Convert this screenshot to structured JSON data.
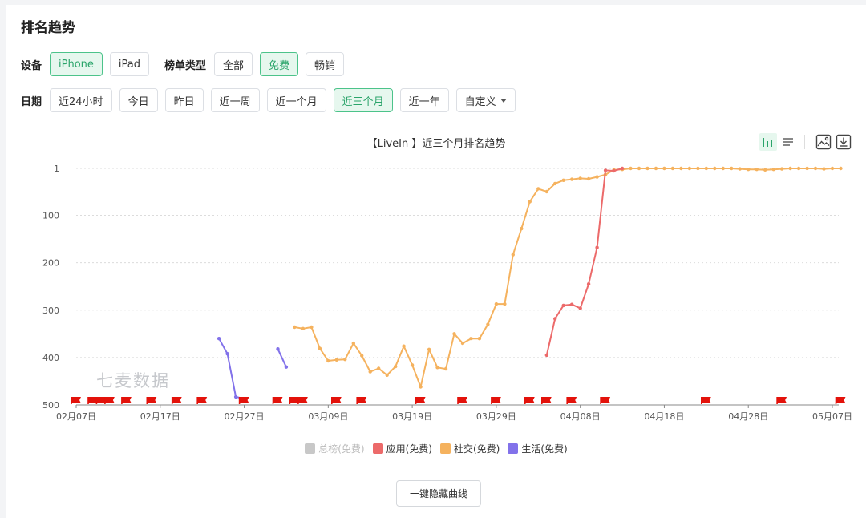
{
  "page": {
    "title": "排名趋势"
  },
  "filters": {
    "device_label": "设备",
    "devices": [
      {
        "label": "iPhone",
        "active": true
      },
      {
        "label": "iPad",
        "active": false
      }
    ],
    "list_type_label": "榜单类型",
    "list_types": [
      {
        "label": "全部",
        "active": false
      },
      {
        "label": "免费",
        "active": true
      },
      {
        "label": "畅销",
        "active": false
      }
    ],
    "date_label": "日期",
    "dates": [
      {
        "label": "近24小时",
        "active": false
      },
      {
        "label": "今日",
        "active": false
      },
      {
        "label": "昨日",
        "active": false
      },
      {
        "label": "近一周",
        "active": false
      },
      {
        "label": "近一个月",
        "active": false
      },
      {
        "label": "近三个月",
        "active": true
      },
      {
        "label": "近一年",
        "active": false
      }
    ],
    "custom_label": "自定义"
  },
  "watermark": "七麦数据",
  "hide_button": "一键隐藏曲线",
  "colors": {
    "accent": "#2aa46a",
    "social": "#f5b25e",
    "app": "#ec6a6a",
    "life": "#8272ea",
    "total": "#c8c8c8",
    "flag": "#e3120b"
  },
  "chart_data": {
    "type": "line",
    "title": "【LiveIn 】近三个月排名趋势",
    "y_reversed": true,
    "ylim": [
      1,
      500
    ],
    "yticks": [
      1,
      100,
      200,
      300,
      400,
      500
    ],
    "x_start": "2024-02-07",
    "x_end": "2024-05-07",
    "xticks": [
      "02月07日",
      "02月17日",
      "02月27日",
      "03月09日",
      "03月19日",
      "03月29日",
      "04月08日",
      "04月18日",
      "04月28日",
      "05月07日"
    ],
    "legend": [
      {
        "name": "总榜(免费)",
        "color": "#c8c8c8",
        "visible": false
      },
      {
        "name": "应用(免费)",
        "color": "#ec6a6a",
        "visible": true
      },
      {
        "name": "社交(免费)",
        "color": "#f5b25e",
        "visible": true
      },
      {
        "name": "生活(免费)",
        "color": "#8272ea",
        "visible": true
      }
    ],
    "series": [
      {
        "name": "生活(免费)",
        "color": "#8272ea",
        "segments": [
          [
            [
              "2024-02-24",
              360
            ],
            [
              "2024-02-25",
              392
            ],
            [
              "2024-02-26",
              483
            ],
            [
              "2024-02-27",
              487
            ]
          ],
          [
            [
              "2024-03-02",
              382
            ],
            [
              "2024-03-03",
              420
            ]
          ]
        ]
      },
      {
        "name": "社交(免费)",
        "color": "#f5b25e",
        "segments": [
          [
            [
              "2024-03-04",
              336
            ],
            [
              "2024-03-05",
              339
            ],
            [
              "2024-03-06",
              336
            ],
            [
              "2024-03-07",
              381
            ],
            [
              "2024-03-08",
              407
            ],
            [
              "2024-03-09",
              405
            ],
            [
              "2024-03-10",
              404
            ],
            [
              "2024-03-11",
              370
            ],
            [
              "2024-03-12",
              396
            ],
            [
              "2024-03-13",
              430
            ],
            [
              "2024-03-14",
              423
            ],
            [
              "2024-03-15",
              437
            ],
            [
              "2024-03-16",
              419
            ],
            [
              "2024-03-17",
              376
            ],
            [
              "2024-03-18",
              416
            ],
            [
              "2024-03-19",
              462
            ],
            [
              "2024-03-20",
              383
            ],
            [
              "2024-03-21",
              421
            ],
            [
              "2024-03-22",
              424
            ],
            [
              "2024-03-23",
              350
            ],
            [
              "2024-03-24",
              370
            ],
            [
              "2024-03-25",
              360
            ],
            [
              "2024-03-26",
              360
            ],
            [
              "2024-03-27",
              330
            ],
            [
              "2024-03-28",
              287
            ],
            [
              "2024-03-29",
              287
            ],
            [
              "2024-03-30",
              183
            ],
            [
              "2024-03-31",
              128
            ],
            [
              "2024-04-01",
              71
            ],
            [
              "2024-04-02",
              44
            ],
            [
              "2024-04-03",
              50
            ],
            [
              "2024-04-04",
              33
            ],
            [
              "2024-04-05",
              26
            ],
            [
              "2024-04-06",
              24
            ],
            [
              "2024-04-07",
              22
            ],
            [
              "2024-04-08",
              23
            ],
            [
              "2024-04-09",
              19
            ],
            [
              "2024-04-10",
              14
            ],
            [
              "2024-04-11",
              4
            ],
            [
              "2024-04-12",
              3
            ],
            [
              "2024-04-13",
              1
            ],
            [
              "2024-04-14",
              1
            ],
            [
              "2024-04-15",
              1
            ],
            [
              "2024-04-16",
              1
            ],
            [
              "2024-04-17",
              1
            ],
            [
              "2024-04-18",
              1
            ],
            [
              "2024-04-19",
              1
            ],
            [
              "2024-04-20",
              1
            ],
            [
              "2024-04-21",
              1
            ],
            [
              "2024-04-22",
              1
            ],
            [
              "2024-04-23",
              1
            ],
            [
              "2024-04-24",
              1
            ],
            [
              "2024-04-25",
              1
            ],
            [
              "2024-04-26",
              2
            ],
            [
              "2024-04-27",
              3
            ],
            [
              "2024-04-28",
              3
            ],
            [
              "2024-04-29",
              4
            ],
            [
              "2024-04-30",
              3
            ],
            [
              "2024-05-01",
              2
            ],
            [
              "2024-05-02",
              1
            ],
            [
              "2024-05-03",
              1
            ],
            [
              "2024-05-04",
              1
            ],
            [
              "2024-05-05",
              1
            ],
            [
              "2024-05-06",
              2
            ],
            [
              "2024-05-07",
              1
            ],
            [
              "2024-05-08",
              1
            ]
          ]
        ]
      },
      {
        "name": "应用(免费)",
        "color": "#ec6a6a",
        "segments": [
          [
            [
              "2024-04-03",
              395
            ],
            [
              "2024-04-04",
              318
            ],
            [
              "2024-04-05",
              290
            ],
            [
              "2024-04-06",
              288
            ],
            [
              "2024-04-07",
              296
            ],
            [
              "2024-04-08",
              245
            ],
            [
              "2024-04-09",
              168
            ],
            [
              "2024-04-10",
              5
            ],
            [
              "2024-04-11",
              6
            ],
            [
              "2024-04-12",
              1
            ]
          ]
        ]
      }
    ],
    "flags": [
      "2024-02-07",
      "2024-02-09",
      "2024-02-10",
      "2024-02-11",
      "2024-02-13",
      "2024-02-16",
      "2024-02-19",
      "2024-02-22",
      "2024-02-27",
      "2024-03-02",
      "2024-03-04",
      "2024-03-05",
      "2024-03-09",
      "2024-03-12",
      "2024-03-19",
      "2024-03-24",
      "2024-03-28",
      "2024-04-01",
      "2024-04-03",
      "2024-04-06",
      "2024-04-10",
      "2024-04-22",
      "2024-05-01",
      "2024-05-08"
    ]
  }
}
